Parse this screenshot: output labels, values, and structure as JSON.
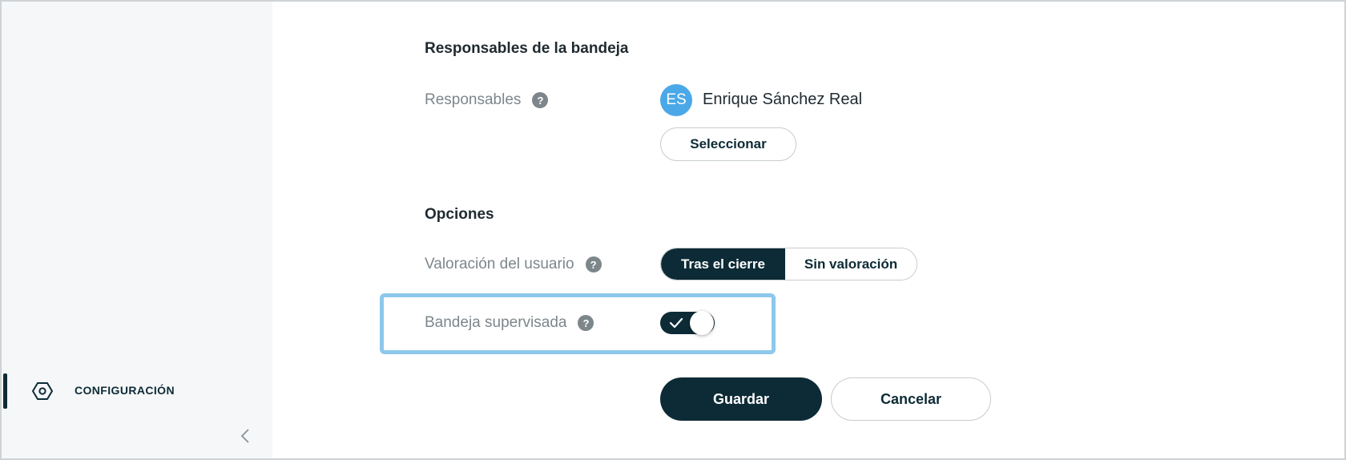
{
  "sidebar": {
    "item": {
      "label": "CONFIGURACIÓN",
      "icon": "settings-hexagon-icon",
      "active": true
    },
    "collapse_icon": "chevron-left-icon"
  },
  "responsables_section": {
    "title": "Responsables de la bandeja",
    "label": "Responsables",
    "help": "?",
    "user": {
      "initials": "ES",
      "name": "Enrique Sánchez Real",
      "avatar_color": "#4aa8e8"
    },
    "select_button": "Seleccionar"
  },
  "opciones_section": {
    "title": "Opciones",
    "valoracion": {
      "label": "Valoración del usuario",
      "help": "?",
      "options": [
        "Tras el cierre",
        "Sin valoración"
      ],
      "selected": "Tras el cierre"
    },
    "supervisada": {
      "label": "Bandeja supervisada",
      "help": "?",
      "enabled": true
    }
  },
  "actions": {
    "save": "Guardar",
    "cancel": "Cancelar"
  },
  "colors": {
    "primary": "#0d2b36",
    "focus": "#8dc8ec",
    "muted": "#7d868b",
    "sidebar_bg": "#f5f7f8"
  }
}
